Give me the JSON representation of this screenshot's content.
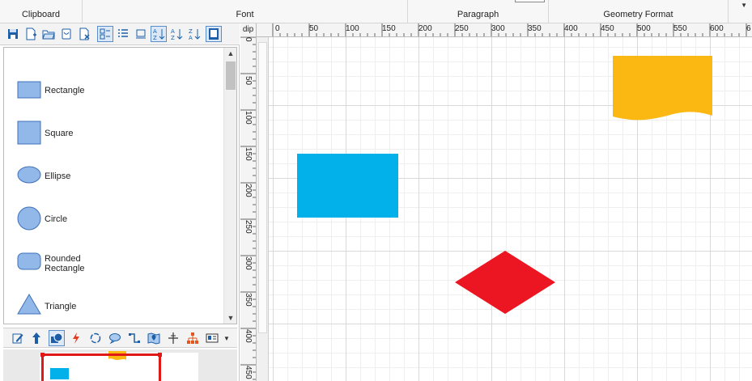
{
  "ribbon": {
    "groups": [
      "Clipboard",
      "Font",
      "Paragraph",
      "Geometry Format"
    ],
    "collapse_icon": "dropdown-triangle-icon"
  },
  "stencil": {
    "shapes": [
      {
        "label": "Rectangle",
        "icon": "rectangle-shape-icon"
      },
      {
        "label": "Square",
        "icon": "square-shape-icon"
      },
      {
        "label": "Ellipse",
        "icon": "ellipse-shape-icon"
      },
      {
        "label": "Circle",
        "icon": "circle-shape-icon"
      },
      {
        "label": "Rounded\nRectangle",
        "icon": "rounded-rectangle-shape-icon"
      },
      {
        "label": "Triangle",
        "icon": "triangle-shape-icon"
      }
    ]
  },
  "ruler": {
    "unit": "dip",
    "h_labels": [
      "0",
      "50",
      "100",
      "150",
      "200",
      "250",
      "300",
      "350",
      "400",
      "450",
      "500",
      "550",
      "600",
      "6"
    ],
    "v_labels": [
      "0",
      "50",
      "100",
      "150",
      "200",
      "250",
      "300",
      "350",
      "400",
      "450"
    ]
  },
  "colors": {
    "shape_fill": "#92b8ea",
    "shape_stroke": "#3f72b8",
    "blue_rect": "#02b0ea",
    "yellow_wave": "#fcb812",
    "red_diamond": "#ec1522"
  }
}
